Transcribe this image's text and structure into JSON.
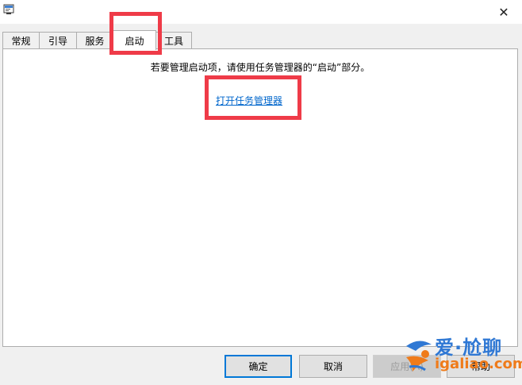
{
  "window": {
    "icon": "msconfig-icon",
    "close_glyph": "✕"
  },
  "tabs": [
    {
      "label": "常规",
      "active": false
    },
    {
      "label": "引导",
      "active": false
    },
    {
      "label": "服务",
      "active": false
    },
    {
      "label": "启动",
      "active": true
    },
    {
      "label": "工具",
      "active": false
    }
  ],
  "startup": {
    "message": "若要管理启动项，请使用任务管理器的“启动”部分。",
    "link_label": "打开任务管理器"
  },
  "buttons": {
    "ok": "确定",
    "cancel": "取消",
    "apply": "应用(A)",
    "help": "帮助"
  },
  "watermark": {
    "title": "爱·尬聊",
    "domain": "igaliao.com"
  },
  "colors": {
    "highlight": "#ef3b48",
    "link": "#0066cc",
    "watermark_blue": "#2f78d4",
    "watermark_orange": "#ef7b1a"
  }
}
